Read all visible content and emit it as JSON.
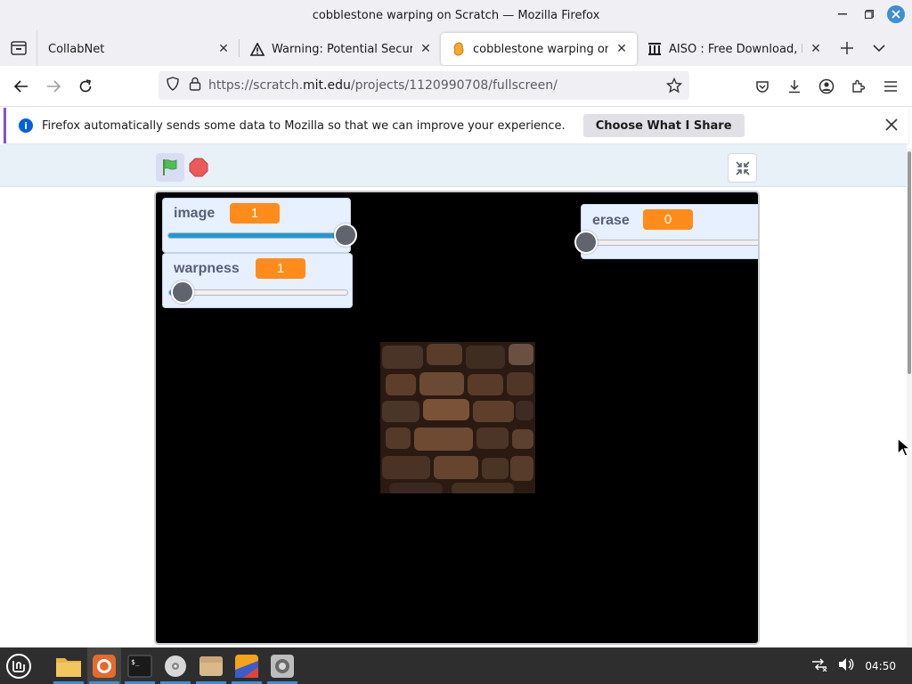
{
  "window": {
    "title": "cobblestone warping on Scratch — Mozilla Firefox"
  },
  "tabs": [
    {
      "title": "CollabNet",
      "active": false,
      "icon": "none"
    },
    {
      "title": "Warning: Potential Security Risk",
      "active": false,
      "icon": "warning-icon"
    },
    {
      "title": "cobblestone warping on Scratch",
      "active": true,
      "icon": "scratch-icon"
    },
    {
      "title": "AISO : Free Download, Borrow",
      "active": false,
      "icon": "archive-icon"
    }
  ],
  "navbar": {
    "url_prefix": "https://scratch.",
    "url_domain": "mit.edu",
    "url_suffix": "/projects/1120990708/fullscreen/"
  },
  "notification": {
    "message": "Firefox automatically sends some data to Mozilla so that we can improve your experience.",
    "button": "Choose What I Share"
  },
  "scratch": {
    "monitors": [
      {
        "name": "image",
        "value": "1",
        "slider_fraction": 1.0
      },
      {
        "name": "warpness",
        "value": "1",
        "slider_fraction": 0.08
      },
      {
        "name": "erase",
        "value": "0",
        "slider_fraction": 0.0
      }
    ]
  },
  "taskbar": {
    "clock": "04:50",
    "apps": [
      "files",
      "firefox",
      "terminal",
      "disc",
      "archive",
      "paint",
      "screenshot"
    ]
  },
  "colors": {
    "accent": "#3d8fd6",
    "monitor_value": "#ff8c1a",
    "slider_fill": "#1f9ad6",
    "stage_bg": "#000000"
  }
}
